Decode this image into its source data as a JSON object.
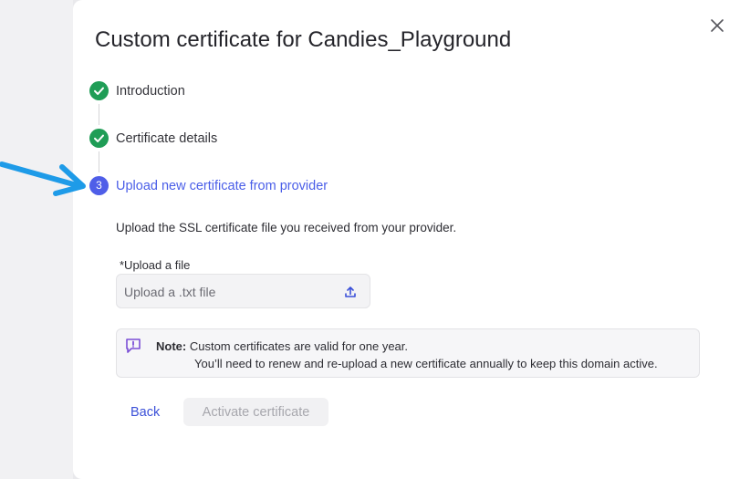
{
  "dialog": {
    "title": "Custom certificate for Candies_Playground"
  },
  "steps": [
    {
      "label": "Introduction",
      "status": "complete"
    },
    {
      "label": "Certificate details",
      "status": "complete"
    },
    {
      "label": "Upload new certificate from provider",
      "status": "active",
      "number": "3"
    }
  ],
  "upload_section": {
    "instructions": "Upload the SSL certificate file you received from your provider.",
    "field_label": "*Upload a file",
    "placeholder": "Upload a .txt file"
  },
  "note": {
    "label": "Note:",
    "line1": "Custom certificates are valid for one year.",
    "line2": "You’ll need to renew and re-upload a new certificate annually to keep this domain active."
  },
  "buttons": {
    "back": "Back",
    "activate": "Activate certificate"
  },
  "colors": {
    "step_complete": "#1f9d56",
    "step_active": "#4f5ee8",
    "link": "#3b50d8",
    "annotation_arrow": "#1e9be8"
  },
  "icons": {
    "close": "close-icon",
    "check": "checkmark-icon",
    "upload": "upload-icon",
    "note": "message-alert-icon"
  }
}
